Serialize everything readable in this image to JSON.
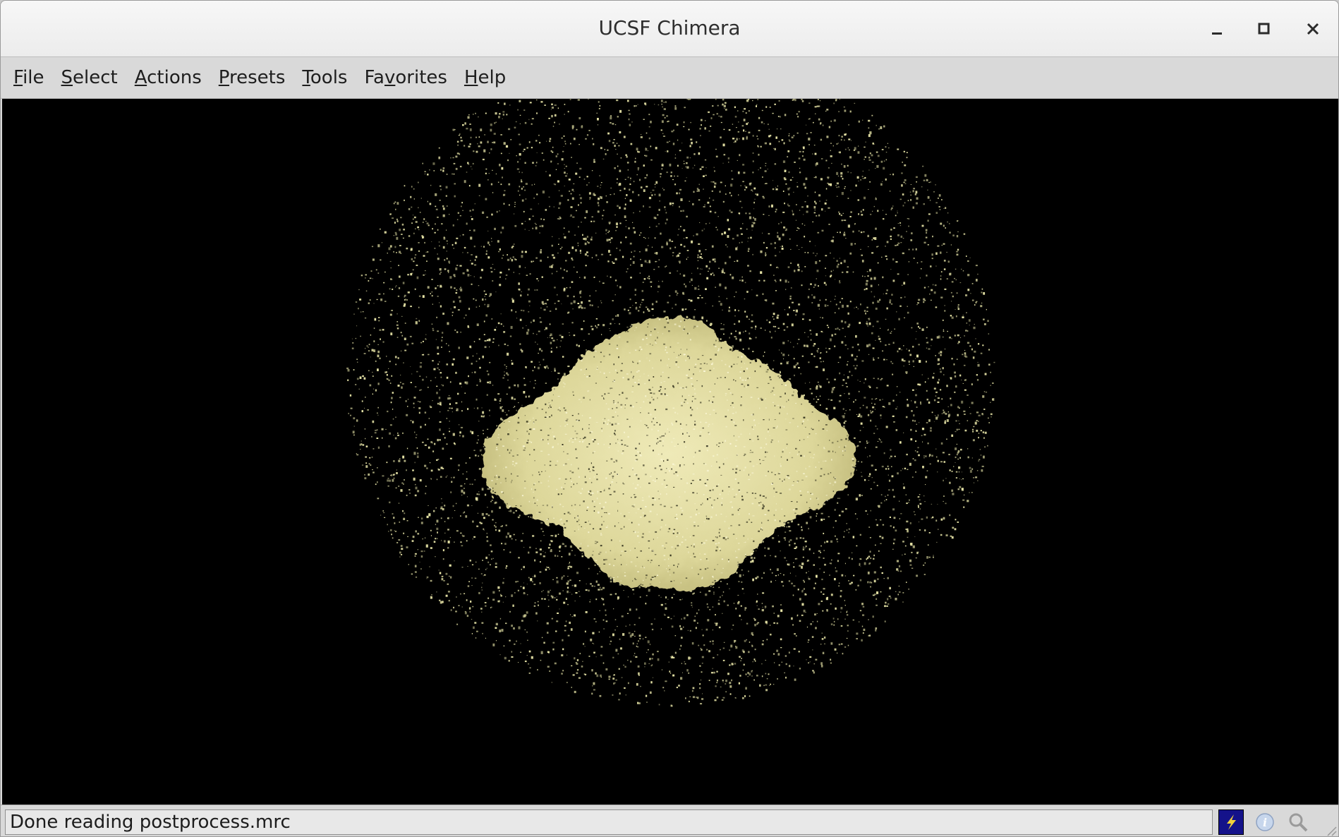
{
  "window": {
    "title": "UCSF Chimera"
  },
  "titlebar_buttons": {
    "minimize_icon": "minimize-icon",
    "maximize_icon": "maximize-icon",
    "close_icon": "close-icon"
  },
  "menubar": {
    "items": [
      {
        "mnemonic": "F",
        "rest": "ile"
      },
      {
        "mnemonic": "S",
        "rest": "elect"
      },
      {
        "mnemonic": "A",
        "rest": "ctions"
      },
      {
        "mnemonic": "P",
        "rest": "resets"
      },
      {
        "mnemonic": "T",
        "rest": "ools"
      },
      {
        "pre": "Fa",
        "mnemonic": "v",
        "rest": "orites"
      },
      {
        "mnemonic": "H",
        "rest": "elp"
      }
    ]
  },
  "viewport": {
    "background": "#000000",
    "surface_color": "#e6e3a6",
    "model": "postprocess.mrc"
  },
  "statusbar": {
    "message": "Done reading postprocess.mrc",
    "icons": [
      "lightning-icon",
      "info-icon",
      "magnifier-icon"
    ]
  }
}
